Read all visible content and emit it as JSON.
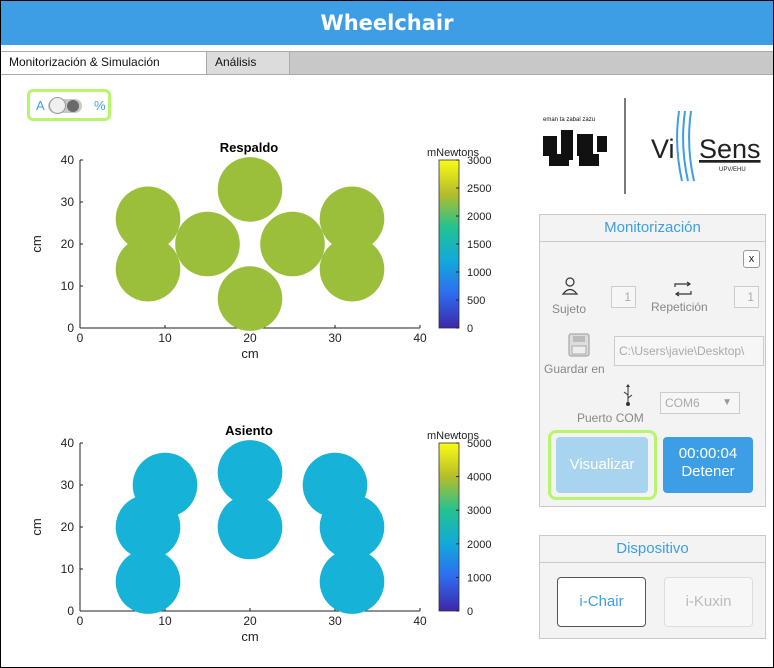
{
  "title": "Wheelchair",
  "tabs": [
    {
      "label": "Monitorización & Simulación"
    },
    {
      "label": "Análisis"
    }
  ],
  "toggle": {
    "left_label": "A",
    "right_label": "%"
  },
  "logos": {
    "university_motto": "eman ta zabal zazu",
    "brand_left": "Vi",
    "brand_right": "Sens",
    "brand_sub": "UPV/EHU"
  },
  "monitorizacion": {
    "title": "Monitorización",
    "close_label": "x",
    "sujeto_label": "Sujeto",
    "sujeto_value": "1",
    "repeticion_label": "Repetición",
    "repeticion_value": "1",
    "guardar_label": "Guardar en",
    "path_value": "C:\\Users\\javie\\Desktop\\",
    "puerto_label": "Puerto COM",
    "com_value": "COM6",
    "visualizar_label": "Visualizar",
    "timer_label": "00:00:04",
    "detener_label": "Detener",
    "colors": {
      "accent": "#3d9ee6",
      "visualizar_bg": "#a9d4f0",
      "detener_bg": "#3d9ee6"
    }
  },
  "dispositivo": {
    "title": "Dispositivo",
    "ichair_label": "i-Chair",
    "ikuxin_label": "i-Kuxin"
  },
  "chart_data": [
    {
      "type": "scatter",
      "title": "Respaldo",
      "xlabel": "cm",
      "ylabel": "cm",
      "xlim": [
        0,
        40
      ],
      "ylim": [
        0,
        40
      ],
      "x_ticks": [
        0,
        10,
        20,
        30,
        40
      ],
      "y_ticks": [
        0,
        10,
        20,
        30,
        40
      ],
      "colorbar": {
        "label": "mNewtons",
        "min": 0,
        "max": 3000,
        "ticks": [
          0,
          500,
          1000,
          1500,
          2000,
          2500,
          3000
        ]
      },
      "point_color": "#9cbf3b",
      "points": [
        {
          "x": 8,
          "y": 26
        },
        {
          "x": 8,
          "y": 14
        },
        {
          "x": 15,
          "y": 20
        },
        {
          "x": 20,
          "y": 33
        },
        {
          "x": 25,
          "y": 20
        },
        {
          "x": 20,
          "y": 7
        },
        {
          "x": 32,
          "y": 26
        },
        {
          "x": 32,
          "y": 14
        }
      ]
    },
    {
      "type": "scatter",
      "title": "Asiento",
      "xlabel": "cm",
      "ylabel": "cm",
      "xlim": [
        0,
        40
      ],
      "ylim": [
        0,
        40
      ],
      "x_ticks": [
        0,
        10,
        20,
        30,
        40
      ],
      "y_ticks": [
        0,
        10,
        20,
        30,
        40
      ],
      "colorbar": {
        "label": "mNewtons",
        "min": 0,
        "max": 5000,
        "ticks": [
          0,
          1000,
          2000,
          3000,
          4000,
          5000
        ]
      },
      "point_color": "#16b2d8",
      "points": [
        {
          "x": 10,
          "y": 30
        },
        {
          "x": 8,
          "y": 20
        },
        {
          "x": 8,
          "y": 7
        },
        {
          "x": 20,
          "y": 33
        },
        {
          "x": 20,
          "y": 20
        },
        {
          "x": 30,
          "y": 30
        },
        {
          "x": 32,
          "y": 20
        },
        {
          "x": 32,
          "y": 7
        }
      ]
    }
  ]
}
